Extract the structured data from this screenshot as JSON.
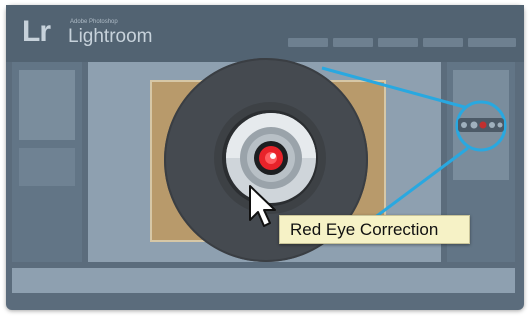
{
  "app": {
    "logo": "Lr",
    "brand_small": "Adobe Photoshop",
    "brand": "Lightroom"
  },
  "tooltip": {
    "label": "Red Eye Correction"
  },
  "colors": {
    "accent": "#29a8e0",
    "red_eye": "#e8232a",
    "frame": "#5b6c7c"
  },
  "icons": {
    "main": "red-eye-correction-icon",
    "cursor": "pointer-cursor-icon"
  }
}
